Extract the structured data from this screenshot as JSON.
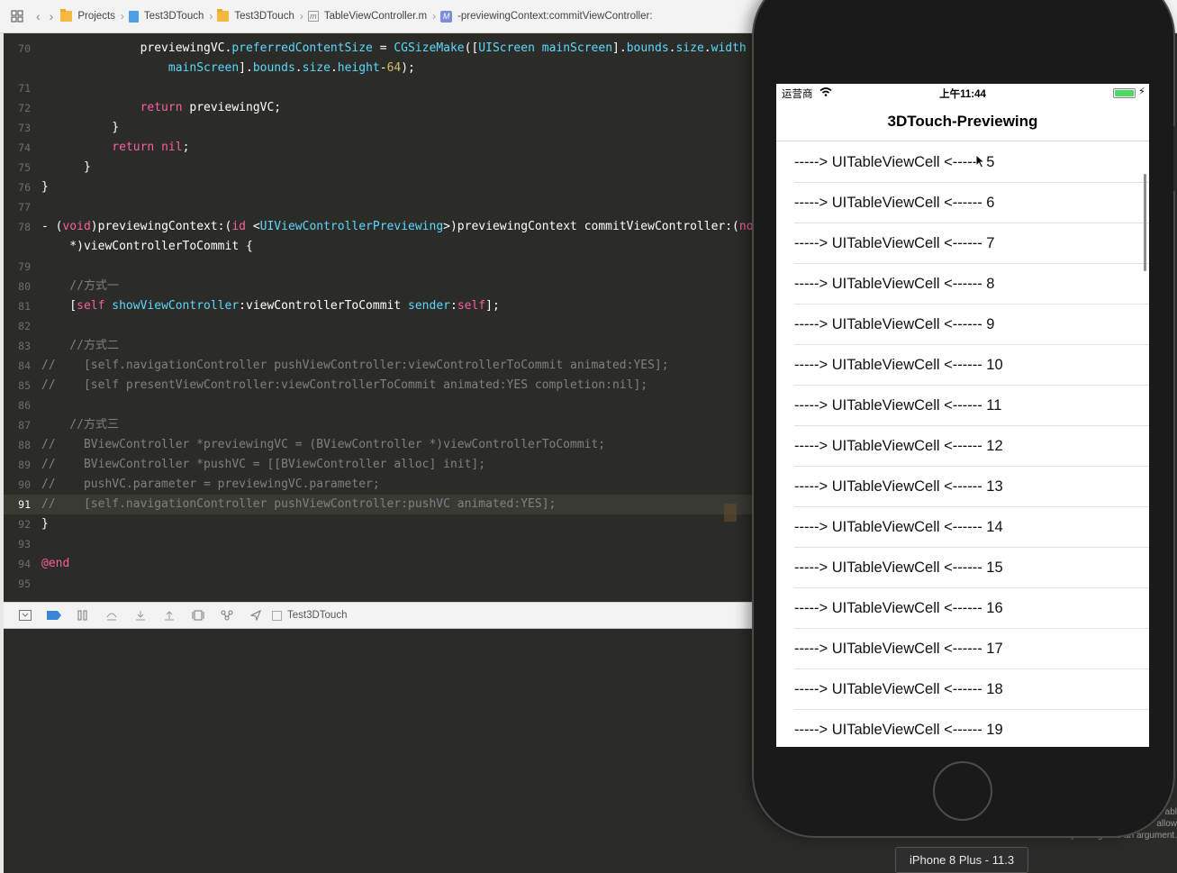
{
  "breadcrumb": {
    "items": [
      "Projects",
      "Test3DTouch",
      "Test3DTouch",
      "TableViewController.m",
      "-previewingContext:commitViewController:"
    ]
  },
  "editor": {
    "lines": [
      {
        "n": "70",
        "html": "<span class='pl'>              previewingVC.</span><span class='ty'>preferredContentSize</span><span class='pl'> = </span><span class='ty'>CGSizeMake</span><span class='pl'>([</span><span class='ty'>UIScreen</span><span class='pl'> </span><span class='ty'>mainScreen</span><span class='pl'>].</span><span class='ty'>bounds</span><span class='pl'>.</span><span class='ty'>size</span><span class='pl'>.</span><span class='ty'>width</span>"
      },
      {
        "n": "",
        "html": "<span class='pl'>                  </span><span class='ty'>mainScreen</span><span class='pl'>].</span><span class='ty'>bounds</span><span class='pl'>.</span><span class='ty'>size</span><span class='pl'>.</span><span class='ty'>height</span><span class='pl'>-</span><span class='nu'>64</span><span class='pl'>);</span>"
      },
      {
        "n": "71",
        "html": ""
      },
      {
        "n": "72",
        "html": "<span class='pl'>              </span><span class='kw'>return</span><span class='pl'> previewingVC;</span>"
      },
      {
        "n": "73",
        "html": "<span class='pl'>          }</span>"
      },
      {
        "n": "74",
        "html": "<span class='pl'>          </span><span class='kw'>return</span><span class='pl'> </span><span class='kw'>nil</span><span class='pl'>;</span>"
      },
      {
        "n": "75",
        "html": "<span class='pl'>      }</span>"
      },
      {
        "n": "76",
        "html": "<span class='pl'>}</span>"
      },
      {
        "n": "77",
        "html": ""
      },
      {
        "n": "78",
        "html": "<span class='pl'>- (</span><span class='kw'>void</span><span class='pl'>)previewingContext:(</span><span class='kw'>id</span><span class='pl'> &lt;</span><span class='ty'>UIViewControllerPreviewing</span><span class='pl'>&gt;)previewingContext commitViewController:(</span><span class='kw'>nonnull</span>"
      },
      {
        "n": "",
        "html": "<span class='pl'>    *)viewControllerToCommit {</span>"
      },
      {
        "n": "79",
        "html": ""
      },
      {
        "n": "80",
        "html": "<span class='cm'>    //方式一</span>"
      },
      {
        "n": "81",
        "html": "<span class='pl'>    [</span><span class='kw'>self</span><span class='pl'> </span><span class='ty'>showViewController</span><span class='pl'>:viewControllerToCommit </span><span class='ty'>sender</span><span class='pl'>:</span><span class='kw'>self</span><span class='pl'>];</span>"
      },
      {
        "n": "82",
        "html": ""
      },
      {
        "n": "83",
        "html": "<span class='cm'>    //方式二</span>"
      },
      {
        "n": "84",
        "html": "<span class='cm'>//    [self.navigationController pushViewController:viewControllerToCommit animated:YES];</span>"
      },
      {
        "n": "85",
        "html": "<span class='cm'>//    [self presentViewController:viewControllerToCommit animated:YES completion:nil];</span>"
      },
      {
        "n": "86",
        "html": ""
      },
      {
        "n": "87",
        "html": "<span class='cm'>    //方式三</span>"
      },
      {
        "n": "88",
        "html": "<span class='cm'>//    BViewController *previewingVC = (BViewController *)viewControllerToCommit;</span>"
      },
      {
        "n": "89",
        "html": "<span class='cm'>//    BViewController *pushVC = [[BViewController alloc] init];</span>"
      },
      {
        "n": "90",
        "html": "<span class='cm'>//    pushVC.parameter = previewingVC.parameter;</span>"
      },
      {
        "n": "91",
        "html": "<span class='cm'>//    [self.navigationController pushViewController:pushVC animated:YES];</span>",
        "highlight": true
      },
      {
        "n": "92",
        "html": "<span class='pl'>}</span>"
      },
      {
        "n": "93",
        "html": ""
      },
      {
        "n": "94",
        "html": "<span class='kw'>@end</span>"
      },
      {
        "n": "95",
        "html": ""
      }
    ]
  },
  "debugbar": {
    "scheme": "Test3DTouch"
  },
  "simulator": {
    "device_label": "iPhone 8 Plus - 11.3",
    "behind_text": "abl\nallow\npassing it as an argument.",
    "status": {
      "carrier": "运营商",
      "time": "上午11:44"
    },
    "nav_title": "3DTouch-Previewing",
    "rows": [
      "-----> UITableViewCell <------ 5",
      "-----> UITableViewCell <------ 6",
      "-----> UITableViewCell <------ 7",
      "-----> UITableViewCell <------ 8",
      "-----> UITableViewCell <------ 9",
      "-----> UITableViewCell <------ 10",
      "-----> UITableViewCell <------ 11",
      "-----> UITableViewCell <------ 12",
      "-----> UITableViewCell <------ 13",
      "-----> UITableViewCell <------ 14",
      "-----> UITableViewCell <------ 15",
      "-----> UITableViewCell <------ 16",
      "-----> UITableViewCell <------ 17",
      "-----> UITableViewCell <------ 18",
      "-----> UITableViewCell <------ 19"
    ]
  },
  "colors": {
    "editor_bg": "#2b2b27",
    "keyword": "#fc5fa3",
    "type": "#5dd8ff",
    "comment": "#808080",
    "number": "#d0bf69",
    "battery": "#4cd964"
  }
}
